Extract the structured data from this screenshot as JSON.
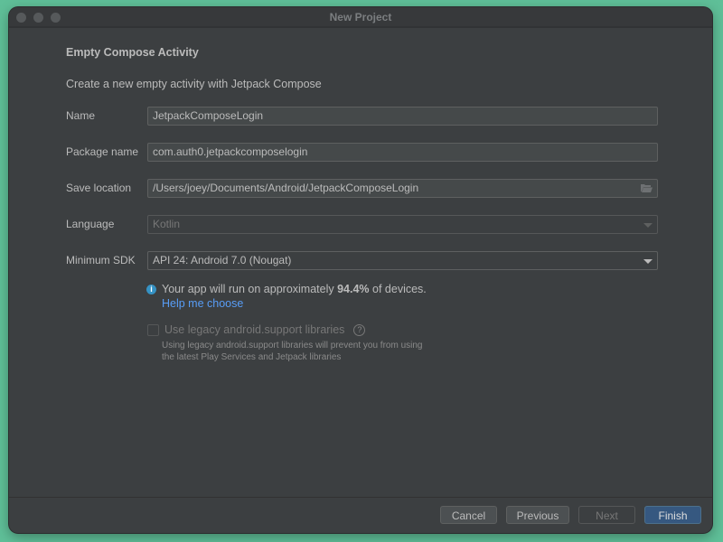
{
  "window": {
    "title": "New Project"
  },
  "heading": "Empty Compose Activity",
  "description": "Create a new empty activity with Jetpack Compose",
  "form": {
    "name": {
      "label": "Name",
      "value": "JetpackComposeLogin"
    },
    "package": {
      "label": "Package name",
      "value": "com.auth0.jetpackcomposelogin"
    },
    "save_location": {
      "label": "Save location",
      "value": "/Users/joey/Documents/Android/JetpackComposeLogin",
      "icon": "folder-icon"
    },
    "language": {
      "label": "Language",
      "value": "Kotlin",
      "disabled": true
    },
    "min_sdk": {
      "label": "Minimum SDK",
      "value": "API 24: Android 7.0 (Nougat)"
    }
  },
  "info": {
    "prefix": "Your app will run on approximately ",
    "percent": "94.4%",
    "suffix": " of devices.",
    "help_link": "Help me choose",
    "icon": "info-icon"
  },
  "legacy": {
    "label": "Use legacy android.support libraries",
    "checked": false,
    "note": "Using legacy android.support libraries will prevent you from using the latest Play Services and Jetpack libraries"
  },
  "buttons": {
    "cancel": "Cancel",
    "previous": "Previous",
    "next": "Next",
    "finish": "Finish"
  },
  "colors": {
    "accent": "#365880",
    "link": "#589df6",
    "background": "#3c3f41"
  }
}
